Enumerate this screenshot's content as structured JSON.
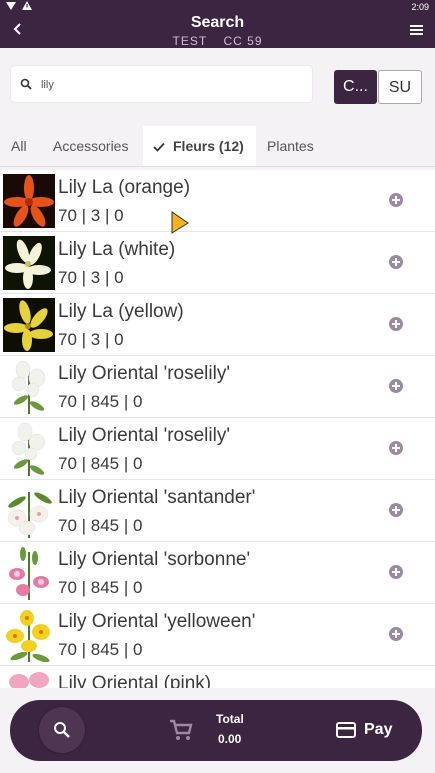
{
  "status_bar": {
    "time": "2:09"
  },
  "header": {
    "title": "Search",
    "sub_left": "TEST",
    "sub_right": "CC 59"
  },
  "search": {
    "value": "lily",
    "placeholder": ""
  },
  "segments": {
    "active": "C...",
    "inactive": "SU"
  },
  "tabs": [
    {
      "label": "All",
      "selected": false
    },
    {
      "label": "Accessories",
      "selected": false
    },
    {
      "label": "Fleurs (12)",
      "selected": true
    },
    {
      "label": "Plantes",
      "selected": false
    }
  ],
  "items": [
    {
      "name": "Lily La (orange)",
      "meta": "70 | 3 | 0"
    },
    {
      "name": "Lily La (white)",
      "meta": "70 | 3 | 0"
    },
    {
      "name": "Lily La (yellow)",
      "meta": "70 | 3 | 0"
    },
    {
      "name": "Lily Oriental 'roselily'",
      "meta": "70 | 845 | 0"
    },
    {
      "name": "Lily Oriental 'roselily'",
      "meta": "70 | 845 | 0"
    },
    {
      "name": "Lily Oriental 'santander'",
      "meta": "70 | 845 | 0"
    },
    {
      "name": "Lily Oriental 'sorbonne'",
      "meta": "70 | 845 | 0"
    },
    {
      "name": "Lily Oriental 'yelloween'",
      "meta": "70 | 845 | 0"
    },
    {
      "name": "Lily Oriental (pink)",
      "meta": ""
    }
  ],
  "bottom": {
    "total_label": "Total",
    "total_value": "0.00",
    "pay_label": "Pay"
  },
  "colors": {
    "primary": "#3c2540",
    "accent": "#9c8aa5"
  }
}
